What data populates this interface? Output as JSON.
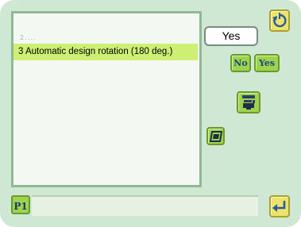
{
  "list": {
    "faint_row": "2....",
    "selected_item": "3 Automatic design rotation (180 deg.)"
  },
  "setting": {
    "current_value": "Yes"
  },
  "buttons": {
    "no_label": "No",
    "yes_label": "Yes",
    "page_label": "P1",
    "top_icon": "rotate-icon",
    "bottom_icon": "return-arrow-icon",
    "middle_icon": "machine-info-icon",
    "lower_icon": "frame-icon"
  },
  "colors": {
    "background": "#cfe8d4",
    "selected_row": "#cdf074",
    "button_green": "#9ed34f",
    "button_yellow": "#ebe36a",
    "panel_border": "#8fb894"
  }
}
